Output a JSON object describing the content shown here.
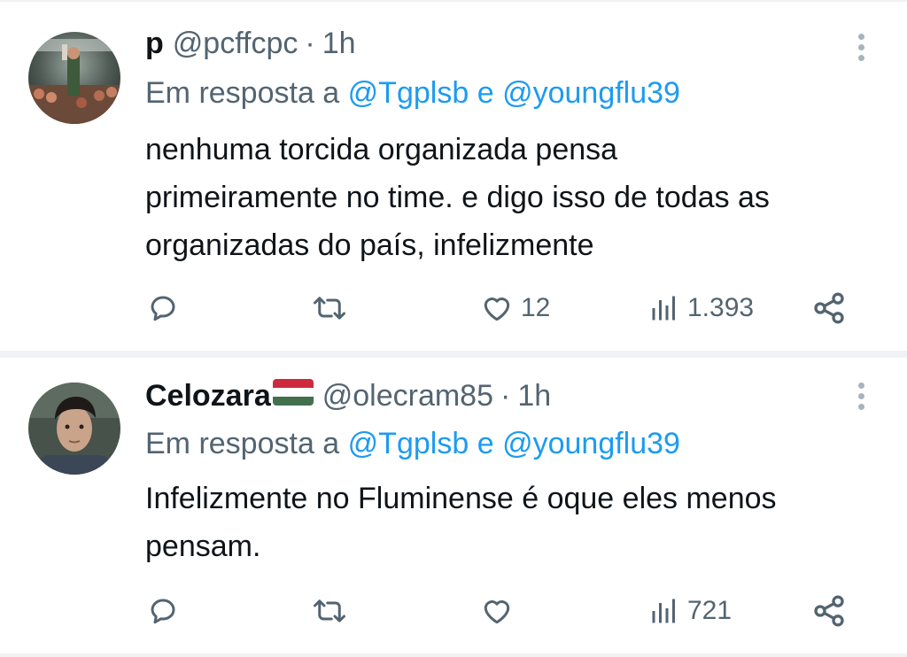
{
  "colors": {
    "text": "#0f1419",
    "secondary": "#536471",
    "link": "#1d9bf0",
    "divider": "#eff3f4"
  },
  "tweets": [
    {
      "name": "p",
      "handle": "@pcffcpc",
      "separator": "·",
      "time": "1h",
      "reply_prefix": "Em resposta a",
      "mention_1": "@Tgplsb",
      "reply_and": "e",
      "mention_2": "@youngflu39",
      "text_lines": [
        "nenhuma torcida organizada pensa",
        "primeiramente no time. e digo isso de todas as",
        "organizadas do país, infelizmente"
      ],
      "icons": [
        "reply-icon",
        "retweet-icon",
        "heart-icon",
        "views-icon",
        "share-icon"
      ],
      "likes": "12",
      "views": "1.393"
    },
    {
      "name": "Celozara",
      "flag": "hungary-flag",
      "handle": "@olecram85",
      "separator": "·",
      "time": "1h",
      "reply_prefix": "Em resposta a",
      "mention_1": "@Tgplsb",
      "reply_and": "e",
      "mention_2": "@youngflu39",
      "text_lines": [
        "Infelizmente no Fluminense é oque eles menos",
        "pensam."
      ],
      "icons": [
        "reply-icon",
        "retweet-icon",
        "heart-icon",
        "views-icon",
        "share-icon"
      ],
      "likes": "",
      "views": "721"
    }
  ]
}
